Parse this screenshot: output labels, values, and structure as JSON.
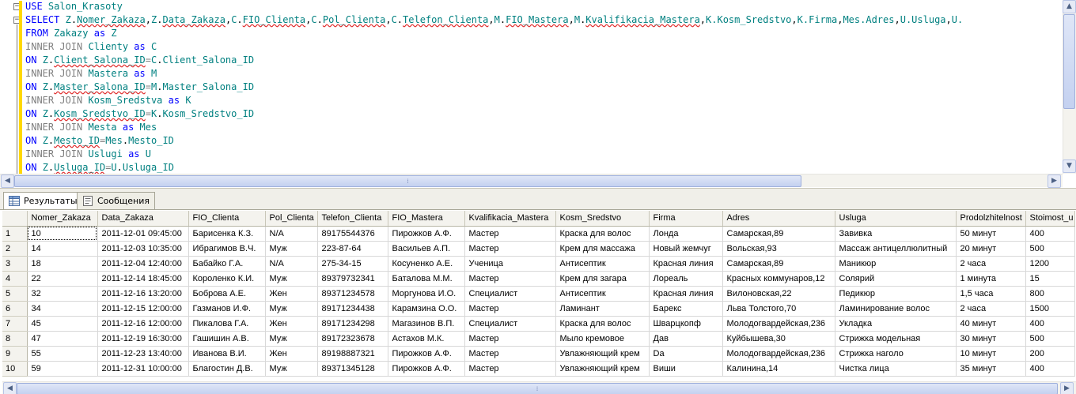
{
  "editor": {
    "lines": [
      [
        [
          "kw",
          "USE"
        ],
        [
          "t",
          " "
        ],
        [
          "tl",
          "Salon_Krasoty"
        ]
      ],
      [
        [
          "kw",
          "SELECT"
        ],
        [
          "t",
          " "
        ],
        [
          "tl",
          "Z"
        ],
        [
          "t",
          "."
        ],
        [
          "sq",
          "Nomer_Zakaza"
        ],
        [
          "t",
          ","
        ],
        [
          "tl",
          "Z"
        ],
        [
          "t",
          "."
        ],
        [
          "sq",
          "Data_Zakaza"
        ],
        [
          "t",
          ","
        ],
        [
          "tl",
          "C"
        ],
        [
          "t",
          "."
        ],
        [
          "sq",
          "FIO_Clienta"
        ],
        [
          "t",
          ","
        ],
        [
          "tl",
          "C"
        ],
        [
          "t",
          "."
        ],
        [
          "sq",
          "Pol_Clienta"
        ],
        [
          "t",
          ","
        ],
        [
          "tl",
          "C"
        ],
        [
          "t",
          "."
        ],
        [
          "sq",
          "Telefon_Clienta"
        ],
        [
          "t",
          ","
        ],
        [
          "tl",
          "M"
        ],
        [
          "t",
          "."
        ],
        [
          "sq",
          "FIO_Mastera"
        ],
        [
          "t",
          ","
        ],
        [
          "tl",
          "M"
        ],
        [
          "t",
          "."
        ],
        [
          "sq",
          "Kvalifikacia_Mastera"
        ],
        [
          "t",
          ","
        ],
        [
          "tl",
          "K.Kosm_Sredstvo"
        ],
        [
          "t",
          ","
        ],
        [
          "tl",
          "K.Firma"
        ],
        [
          "t",
          ","
        ],
        [
          "tl",
          "Mes.Adres"
        ],
        [
          "t",
          ","
        ],
        [
          "tl",
          "U.Usluga"
        ],
        [
          "t",
          ","
        ],
        [
          "tl",
          "U."
        ]
      ],
      [
        [
          "kw",
          "FROM"
        ],
        [
          "t",
          " "
        ],
        [
          "tl",
          "Zakazy"
        ],
        [
          "t",
          " "
        ],
        [
          "kw",
          "as"
        ],
        [
          "t",
          " "
        ],
        [
          "tl",
          "Z"
        ]
      ],
      [
        [
          "gr",
          "INNER JOIN"
        ],
        [
          "t",
          " "
        ],
        [
          "tl",
          "Clienty"
        ],
        [
          "t",
          " "
        ],
        [
          "kw",
          "as"
        ],
        [
          "t",
          " "
        ],
        [
          "tl",
          "C"
        ]
      ],
      [
        [
          "kw",
          "ON"
        ],
        [
          "t",
          " "
        ],
        [
          "tl",
          "Z"
        ],
        [
          "t",
          "."
        ],
        [
          "sq",
          "Client_Salona_ID"
        ],
        [
          "gr",
          "="
        ],
        [
          "tl",
          "C"
        ],
        [
          "t",
          "."
        ],
        [
          "tl",
          "Client_Salona_ID"
        ]
      ],
      [
        [
          "gr",
          "INNER JOIN"
        ],
        [
          "t",
          " "
        ],
        [
          "tl",
          "Mastera"
        ],
        [
          "t",
          " "
        ],
        [
          "kw",
          "as"
        ],
        [
          "t",
          " "
        ],
        [
          "tl",
          "M"
        ]
      ],
      [
        [
          "kw",
          "ON"
        ],
        [
          "t",
          " "
        ],
        [
          "tl",
          "Z"
        ],
        [
          "t",
          "."
        ],
        [
          "sq",
          "Master_Salona_ID"
        ],
        [
          "gr",
          "="
        ],
        [
          "tl",
          "M"
        ],
        [
          "t",
          "."
        ],
        [
          "tl",
          "Master_Salona_ID"
        ]
      ],
      [
        [
          "gr",
          "INNER JOIN"
        ],
        [
          "t",
          " "
        ],
        [
          "tl",
          "Kosm_Sredstva"
        ],
        [
          "t",
          " "
        ],
        [
          "kw",
          "as"
        ],
        [
          "t",
          " "
        ],
        [
          "tl",
          "K"
        ]
      ],
      [
        [
          "kw",
          "ON"
        ],
        [
          "t",
          " "
        ],
        [
          "tl",
          "Z"
        ],
        [
          "t",
          "."
        ],
        [
          "sq",
          "Kosm_Sredstvo_ID"
        ],
        [
          "gr",
          "="
        ],
        [
          "tl",
          "K"
        ],
        [
          "t",
          "."
        ],
        [
          "tl",
          "Kosm_Sredstvo_ID"
        ]
      ],
      [
        [
          "gr",
          "INNER JOIN"
        ],
        [
          "t",
          " "
        ],
        [
          "tl",
          "Mesta"
        ],
        [
          "t",
          " "
        ],
        [
          "kw",
          "as"
        ],
        [
          "t",
          " "
        ],
        [
          "tl",
          "Mes"
        ]
      ],
      [
        [
          "kw",
          "ON"
        ],
        [
          "t",
          " "
        ],
        [
          "tl",
          "Z"
        ],
        [
          "t",
          "."
        ],
        [
          "sq",
          "Mesto_ID"
        ],
        [
          "gr",
          "="
        ],
        [
          "tl",
          "Mes"
        ],
        [
          "t",
          "."
        ],
        [
          "tl",
          "Mesto_ID"
        ]
      ],
      [
        [
          "gr",
          "INNER JOIN"
        ],
        [
          "t",
          " "
        ],
        [
          "tl",
          "Uslugi"
        ],
        [
          "t",
          " "
        ],
        [
          "kw",
          "as"
        ],
        [
          "t",
          " "
        ],
        [
          "tl",
          "U"
        ]
      ],
      [
        [
          "kw",
          "ON"
        ],
        [
          "t",
          " "
        ],
        [
          "tl",
          "Z"
        ],
        [
          "t",
          "."
        ],
        [
          "sq",
          "Usluga_ID"
        ],
        [
          "gr",
          "="
        ],
        [
          "tl",
          "U"
        ],
        [
          "t",
          "."
        ],
        [
          "tl",
          "Usluga_ID"
        ]
      ]
    ]
  },
  "tabs": [
    {
      "label": "Результаты",
      "icon": "grid-icon",
      "active": true
    },
    {
      "label": "Сообщения",
      "icon": "messages-icon",
      "active": false
    }
  ],
  "results": {
    "columns": [
      "Nomer_Zakaza",
      "Data_Zakaza",
      "FIO_Clienta",
      "Pol_Clienta",
      "Telefon_Clienta",
      "FIO_Mastera",
      "Kvalifikacia_Mastera",
      "Kosm_Sredstvo",
      "Firma",
      "Adres",
      "Usluga",
      "Prodolzhitelnost",
      "Stoimost_u"
    ],
    "rows": [
      [
        "1",
        "10",
        "2011-12-01 09:45:00",
        "Барисенка К.З.",
        "N/A",
        "89175544376",
        "Пирожков А.Ф.",
        "Мастер",
        "Краска для волос",
        "Лонда",
        "Самарская,89",
        "Завивка",
        "50 минут",
        "400"
      ],
      [
        "2",
        "14",
        "2011-12-03 10:35:00",
        "Ибрагимов В.Ч.",
        "Муж",
        "223-87-64",
        "Васильев А.П.",
        "Мастер",
        "Крем для массажа",
        "Новый жемчуг",
        "Вольская,93",
        "Массаж антицеллюлитный",
        "20 минут",
        "500"
      ],
      [
        "3",
        "18",
        "2011-12-04 12:40:00",
        "Бабайко Г.А.",
        "N/A",
        "275-34-15",
        "Косуненко А.Е.",
        "Ученица",
        "Антисептик",
        "Красная линия",
        "Самарская,89",
        "Маникюр",
        "2 часа",
        "1200"
      ],
      [
        "4",
        "22",
        "2011-12-14 18:45:00",
        "Короленко К.И.",
        "Муж",
        "89379732341",
        "Баталова М.М.",
        "Мастер",
        "Крем для загара",
        "Лореаль",
        "Красных коммунаров,12",
        "Солярий",
        "1 минута",
        "15"
      ],
      [
        "5",
        "32",
        "2011-12-16 13:20:00",
        "Боброва А.Е.",
        "Жен",
        "89371234578",
        "Моргунова И.О.",
        "Специалист",
        "Антисептик",
        "Красная линия",
        "Вилоновская,22",
        "Педикюр",
        "1,5 часа",
        "800"
      ],
      [
        "6",
        "34",
        "2011-12-15 12:00:00",
        "Газманов И.Ф.",
        "Муж",
        "89171234438",
        "Карамзина О.О.",
        "Мастер",
        "Ламинант",
        "Барекс",
        "Льва Толстого,70",
        "Ламинирование волос",
        "2 часа",
        "1500"
      ],
      [
        "7",
        "45",
        "2011-12-16 12:00:00",
        "Пикалова Г.А.",
        "Жен",
        "89171234298",
        "Магазинов В.П.",
        "Специалист",
        "Краска для волос",
        "Шварцкопф",
        "Молодогвардейская,236",
        "Укладка",
        "40 минут",
        "400"
      ],
      [
        "8",
        "47",
        "2011-12-19 16:30:00",
        "Гашишин А.В.",
        "Муж",
        "89172323678",
        "Астахов М.К.",
        "Мастер",
        "Мыло кремовое",
        "Дав",
        "Куйбышева,30",
        "Стрижка модельная",
        "30 минут",
        "500"
      ],
      [
        "9",
        "55",
        "2011-12-23 13:40:00",
        "Иванова В.И.",
        "Жен",
        "89198887321",
        "Пирожков А.Ф.",
        "Мастер",
        "Увлажняющий крем",
        "Da",
        "Молодогвардейская,236",
        "Стрижка наголо",
        "10 минут",
        "200"
      ],
      [
        "10",
        "59",
        "2011-12-31 10:00:00",
        "Благостин Д.В.",
        "Муж",
        "89371345128",
        "Пирожков А.Ф.",
        "Мастер",
        "Увлажняющий крем",
        "Виши",
        "Калинина,14",
        "Чистка лица",
        "35 минут",
        "400"
      ]
    ]
  }
}
